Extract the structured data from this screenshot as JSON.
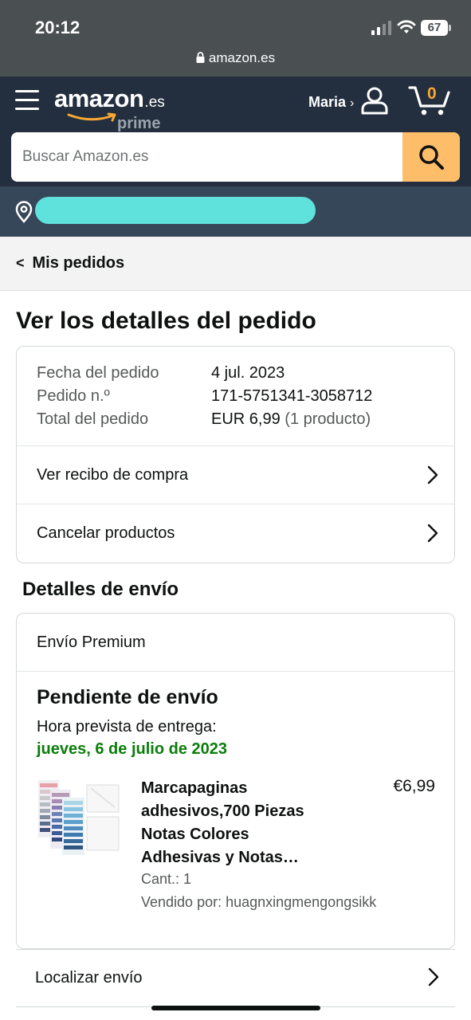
{
  "status_bar": {
    "time": "20:12",
    "battery": "67"
  },
  "browser": {
    "url": "amazon.es"
  },
  "header": {
    "logo_word": "amazon",
    "logo_tld": ".es",
    "logo_prime": "prime",
    "account_label": "Maria",
    "account_chevron": "›",
    "cart_count": "0"
  },
  "search": {
    "placeholder": "Buscar Amazon.es"
  },
  "breadcrumb": {
    "label": "Mis pedidos",
    "back_glyph": "<"
  },
  "page": {
    "title": "Ver los detalles del pedido"
  },
  "order_summary": {
    "rows": [
      {
        "label": "Fecha del pedido",
        "value": "4 jul. 2023"
      },
      {
        "label": "Pedido n.º",
        "value": "171-5751341-3058712"
      },
      {
        "label": "Total del pedido",
        "value": "EUR 6,99",
        "extra": "(1 producto)"
      }
    ],
    "actions": [
      "Ver recibo de compra",
      "Cancelar productos"
    ]
  },
  "shipping": {
    "section_title": "Detalles de envío",
    "method": "Envío Premium",
    "status": "Pendiente de envío",
    "eta_label": "Hora prevista de entrega:",
    "eta_date": "jueves, 6 de julio de 2023",
    "status_color": "#0a7d0a",
    "item": {
      "title": "Marcapaginas adhesivos,700 Piezas Notas Colores Adhesivas y Notas…",
      "price": "€6,99",
      "quantity": "Cant.: 1",
      "seller": "Vendido por: huagnxingmengongsikk"
    }
  },
  "track": {
    "label": "Localizar envío"
  },
  "colors": {
    "header_bg": "#232f3e",
    "search_button": "#febd69",
    "cart_count": "#f7a833",
    "deliver_bar": "#37475a"
  }
}
